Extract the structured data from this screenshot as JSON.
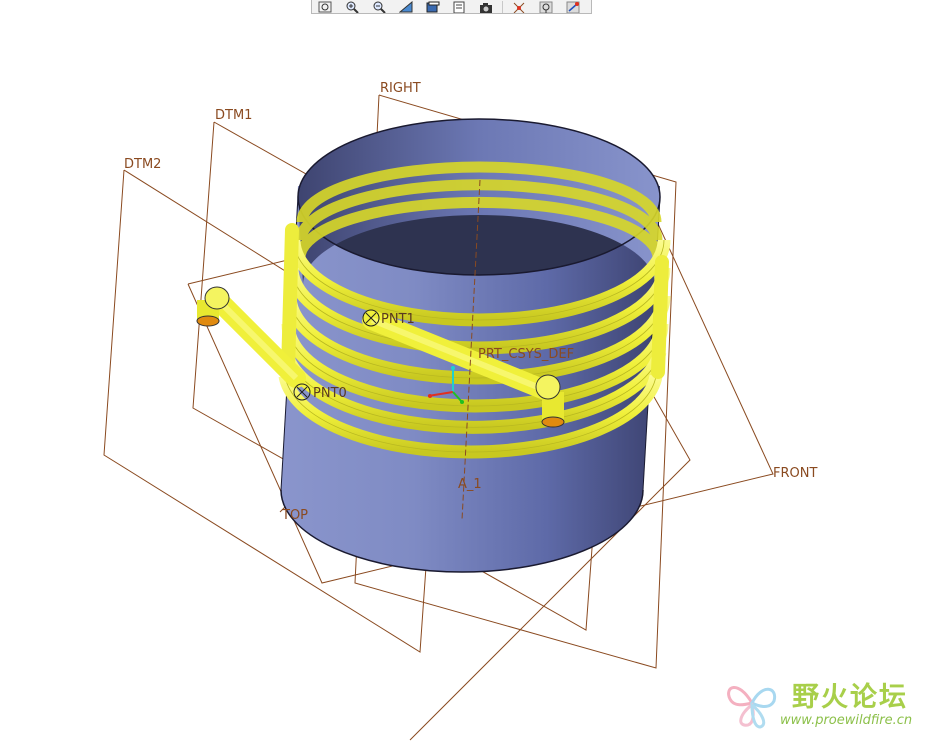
{
  "viewport": {
    "datum_planes": {
      "right": "RIGHT",
      "dtm1": "DTM1",
      "dtm2": "DTM2",
      "front": "FRONT",
      "top": "TOP"
    },
    "datum_points": {
      "pnt0": "PNT0",
      "pnt1": "PNT1"
    },
    "coordinate_system": "PRT_CSYS_DEF",
    "axis_label": "A_1"
  },
  "toolbar": {
    "buttons": [
      {
        "name": "zoom-fit-icon"
      },
      {
        "name": "zoom-in-icon"
      },
      {
        "name": "zoom-out-icon"
      },
      {
        "name": "repaint-icon"
      },
      {
        "name": "display-style-icon"
      },
      {
        "name": "saved-views-icon"
      },
      {
        "name": "camera-icon"
      },
      {
        "name": "datum-planes-icon"
      },
      {
        "name": "datum-axes-icon"
      },
      {
        "name": "datum-points-icon"
      }
    ]
  },
  "watermark": {
    "site_name": "野火论坛",
    "url": "www.proewildfire.cn"
  },
  "colors": {
    "datum_line": "#8a4a20",
    "cylinder": "#7a86c0",
    "coil": "#f0f040",
    "background": "#ffffff"
  }
}
